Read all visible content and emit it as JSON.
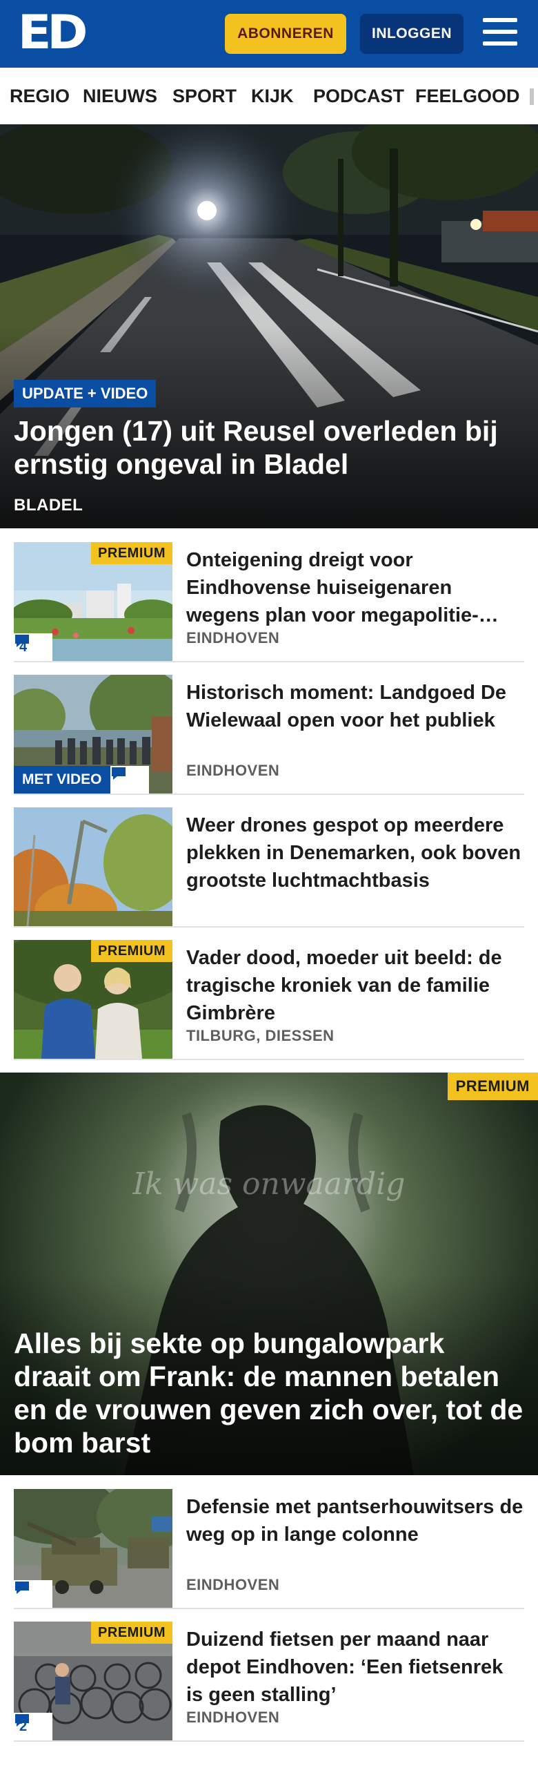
{
  "header": {
    "logo": "ED",
    "subscribe_label": "ABONNEREN",
    "login_label": "INLOGGEN"
  },
  "nav": {
    "items": [
      "REGIO",
      "NIEUWS",
      "SPORT",
      "KIJK",
      "PODCAST",
      "FEELGOOD"
    ]
  },
  "hero": {
    "badge": "UPDATE + VIDEO",
    "title": "Jongen (17) uit Reusel overleden bij ernstig ongeval in Bladel",
    "location": "BLADEL"
  },
  "articles": [
    {
      "title": "Onteigening dreigt voor Eindhovense huiseigenaren wegens plan voor megapolitie-…",
      "location": "EINDHOVEN",
      "premium": "PREMIUM",
      "comments": "4"
    },
    {
      "title": "Historisch moment: Landgoed De Wielewaal open voor het publiek",
      "location": "EINDHOVEN",
      "video": "MET VIDEO"
    },
    {
      "title": "Weer drones gespot op meerdere plekken in Denemarken, ook boven grootste luchtmachtbasis"
    },
    {
      "title": "Vader dood, moeder uit beeld: de tragische kroniek van de familie Gimbrère",
      "location": "TILBURG, DIESSEN",
      "premium": "PREMIUM"
    }
  ],
  "feature": {
    "premium": "PREMIUM",
    "watermark": "Ik was onwaardig",
    "title": "Alles bij sekte op bungalowpark draait om Frank: de mannen betalen en de vrouwen geven zich over, tot de bom barst"
  },
  "articles2": [
    {
      "title": "Defensie met pantserhouwitsers de weg op in lange colonne",
      "location": "EINDHOVEN"
    },
    {
      "title": "Duizend fietsen per maand naar depot Eindhoven: ‘Een fietsenrek is geen stalling’",
      "location": "EINDHOVEN",
      "premium": "PREMIUM",
      "comments": "2"
    }
  ],
  "colors": {
    "brand_blue": "#0a4ea3",
    "premium_yellow": "#f4c21f"
  },
  "icons": [
    "menu-icon",
    "comment-icon"
  ]
}
